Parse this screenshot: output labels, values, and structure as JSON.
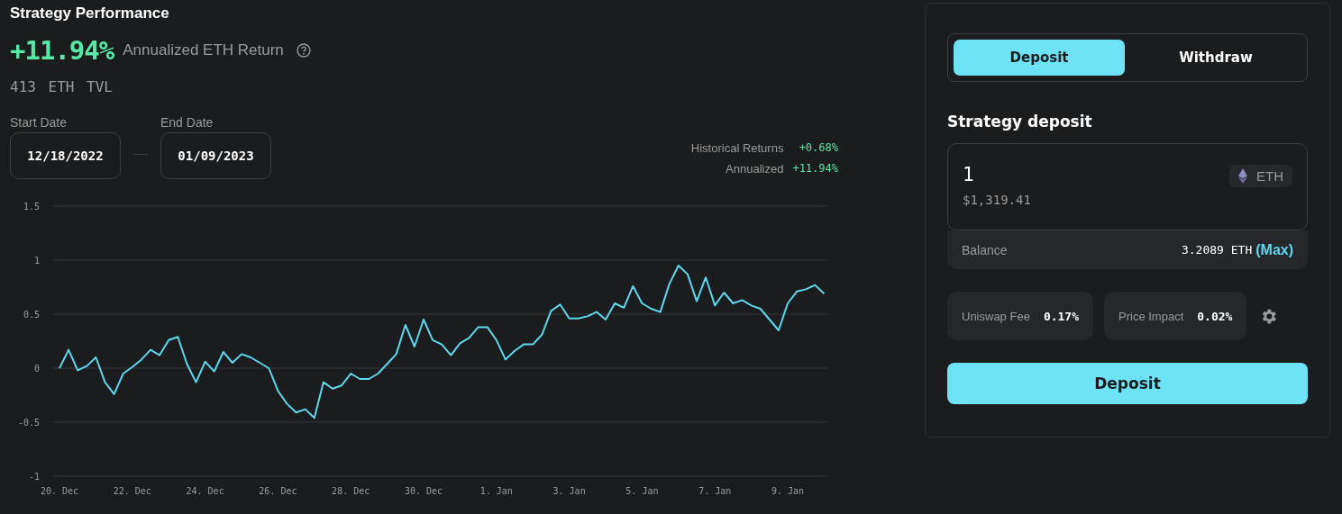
{
  "title": "Strategy Performance",
  "headline": {
    "value": "+11.94%",
    "label": "Annualized ETH Return"
  },
  "tvl": "413 ETH TVL",
  "dates": [
    {
      "label": "Start Date",
      "value": "12/18/2022"
    },
    {
      "label": "End Date",
      "value": "01/09/2023"
    }
  ],
  "returns": [
    {
      "label": "Historical Returns",
      "value": "+0.68%"
    },
    {
      "label": "Annualized",
      "value": "+11.94%"
    }
  ],
  "chart_data": {
    "type": "line",
    "grid": true,
    "ylim": [
      -1,
      1.5
    ],
    "yticks": [
      -1,
      -0.5,
      0,
      0.5,
      1,
      1.5
    ],
    "categories": [
      "20. Dec",
      null,
      null,
      null,
      null,
      null,
      null,
      null,
      "22. Dec",
      null,
      null,
      null,
      null,
      null,
      null,
      null,
      "24. Dec",
      null,
      null,
      null,
      null,
      null,
      null,
      null,
      "26. Dec",
      null,
      null,
      null,
      null,
      null,
      null,
      null,
      "28. Dec",
      null,
      null,
      null,
      null,
      null,
      null,
      null,
      "30. Dec",
      null,
      null,
      null,
      null,
      null,
      null,
      null,
      "1. Jan",
      null,
      null,
      null,
      null,
      null,
      null,
      null,
      "3. Jan",
      null,
      null,
      null,
      null,
      null,
      null,
      null,
      "5. Jan",
      null,
      null,
      null,
      null,
      null,
      null,
      null,
      "7. Jan",
      null,
      null,
      null,
      null,
      null,
      null,
      null,
      "9. Jan",
      null,
      null,
      null,
      null
    ],
    "series": [
      {
        "color": "#5ed8f0",
        "values": [
          0,
          0.17,
          -0.02,
          0.02,
          0.1,
          -0.13,
          -0.24,
          -0.05,
          0.01,
          0.08,
          0.17,
          0.12,
          0.26,
          0.29,
          0.04,
          -0.13,
          0.06,
          -0.03,
          0.15,
          0.05,
          0.13,
          0.1,
          0.05,
          0,
          -0.21,
          -0.33,
          -0.41,
          -0.38,
          -0.46,
          -0.13,
          -0.19,
          -0.16,
          -0.05,
          -0.1,
          -0.1,
          -0.05,
          0.04,
          0.13,
          0.4,
          0.2,
          0.45,
          0.26,
          0.22,
          0.12,
          0.23,
          0.28,
          0.38,
          0.38,
          0.26,
          0.08,
          0.16,
          0.22,
          0.22,
          0.31,
          0.53,
          0.59,
          0.46,
          0.46,
          0.48,
          0.52,
          0.45,
          0.6,
          0.56,
          0.76,
          0.6,
          0.55,
          0.52,
          0.78,
          0.95,
          0.87,
          0.62,
          0.84,
          0.58,
          0.7,
          0.6,
          0.63,
          0.58,
          0.55,
          0.45,
          0.35,
          0.6,
          0.71,
          0.73,
          0.77,
          0.69
        ]
      }
    ]
  },
  "panel": {
    "tabs": [
      {
        "label": "Deposit",
        "selected": true
      },
      {
        "label": "Withdraw",
        "selected": false
      }
    ],
    "section_title": "Strategy deposit",
    "amount": {
      "value": "1",
      "usd": "$1,319.41",
      "token": "ETH"
    },
    "balance": {
      "label": "Balance",
      "value": "3.2089 ETH",
      "max": "(Max)"
    },
    "fees": [
      {
        "label": "Uniswap Fee",
        "value": "0.17%"
      },
      {
        "label": "Price Impact",
        "value": "0.02%"
      }
    ],
    "action": "Deposit"
  }
}
